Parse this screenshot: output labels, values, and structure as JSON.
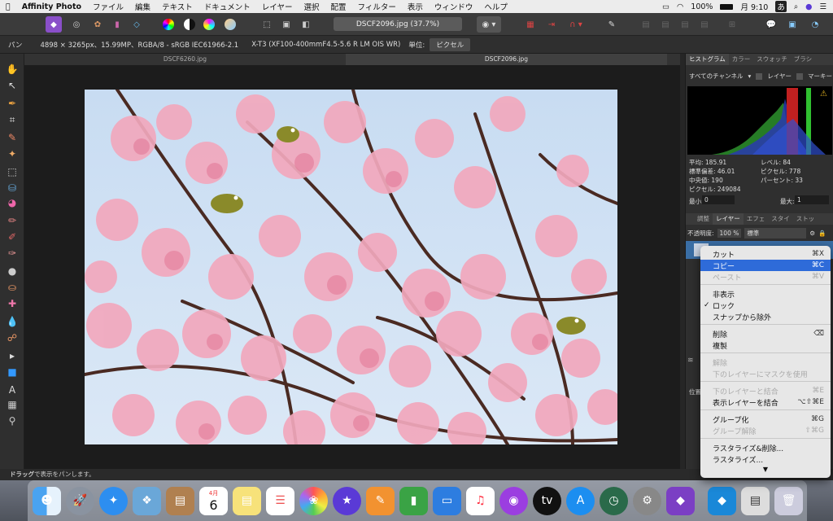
{
  "menubar": {
    "app": "Affinity Photo",
    "items": [
      "ファイル",
      "編集",
      "テキスト",
      "ドキュメント",
      "レイヤー",
      "選択",
      "配置",
      "フィルター",
      "表示",
      "ウィンドウ",
      "ヘルプ"
    ],
    "battery": "100%",
    "clock": "月 9:10",
    "input": "あ"
  },
  "toolbar": {
    "doc_title": "DSCF2096.jpg (37.7%)"
  },
  "context": {
    "mode": "パン",
    "info": "4898 × 3265px、15.99MP、RGBA/8 - sRGB IEC61966-2.1",
    "camera": "X-T3 (XF100-400mmF4.5-5.6 R LM OIS WR)",
    "unit_label": "単位:",
    "unit_value": "ピクセル"
  },
  "tabs": [
    "DSCF6260.jpg",
    "DSCF2096.jpg"
  ],
  "panel": {
    "top_tabs": [
      "ヒストグラム",
      "カラー",
      "スウォッチ",
      "ブラシ"
    ],
    "channel": "すべてのチャンネル",
    "layer_check": "レイヤー",
    "marquee_check": "マーキー",
    "stats": {
      "mean": "平均: 185.91",
      "std": "標準偏差: 46.01",
      "median": "中央値: 190",
      "pixels": "ピクセル: 249084",
      "level": "レベル: 84",
      "pix2": "ピクセル: 778",
      "percent": "パーセント: 33"
    },
    "min_label": "最小:",
    "min_value": "0",
    "max_label": "最大:",
    "max_value": "1",
    "mid_tabs": [
      "調整",
      "レイヤー",
      "エフェ",
      "スタイ",
      "ストッ"
    ],
    "opacity_label": "不透明度:",
    "opacity_value": "100 %",
    "blend": "標準",
    "pos_label": "位置:"
  },
  "status": {
    "bold": "ドラッグ",
    "rest": "で表示をパンします。"
  },
  "context_menu": {
    "items": [
      {
        "label": "カット",
        "shortcut": "⌘X",
        "state": "normal"
      },
      {
        "label": "コピー",
        "shortcut": "⌘C",
        "state": "highlight"
      },
      {
        "label": "ペースト",
        "shortcut": "⌘V",
        "state": "disabled"
      },
      {
        "label": "非表示",
        "shortcut": "",
        "state": "normal"
      },
      {
        "label": "ロック",
        "shortcut": "",
        "state": "checked"
      },
      {
        "label": "スナップから除外",
        "shortcut": "",
        "state": "normal"
      },
      {
        "label": "削除",
        "shortcut": "⌫",
        "state": "normal"
      },
      {
        "label": "複製",
        "shortcut": "",
        "state": "normal"
      },
      {
        "label": "解除",
        "shortcut": "",
        "state": "disabled"
      },
      {
        "label": "下のレイヤーにマスクを使用",
        "shortcut": "",
        "state": "disabled"
      },
      {
        "label": "下のレイヤーと結合",
        "shortcut": "⌘E",
        "state": "disabled"
      },
      {
        "label": "表示レイヤーを結合",
        "shortcut": "⌥⇧⌘E",
        "state": "normal"
      },
      {
        "label": "グループ化",
        "shortcut": "⌘G",
        "state": "normal"
      },
      {
        "label": "グループ解除",
        "shortcut": "⇧⌘G",
        "state": "disabled"
      },
      {
        "label": "ラスタライズ&削除...",
        "shortcut": "",
        "state": "normal"
      },
      {
        "label": "ラスタライズ...",
        "shortcut": "",
        "state": "normal"
      }
    ],
    "more_arrow": "▼"
  },
  "dock": {
    "calendar_month": "4月",
    "calendar_day": "6"
  },
  "colors": {
    "accent": "#2e6bd9",
    "panel_bg": "#2f2f2f"
  }
}
